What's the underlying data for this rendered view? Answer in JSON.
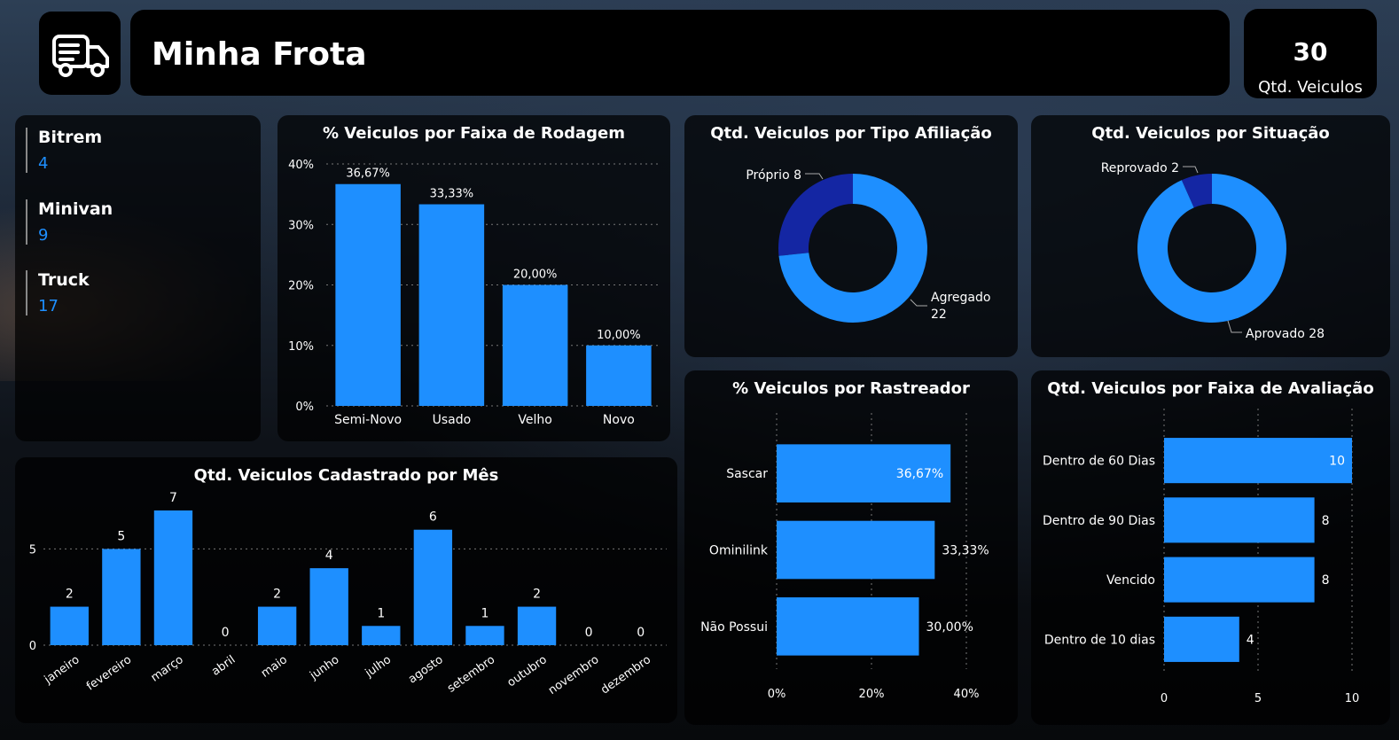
{
  "header": {
    "title": "Minha Frota",
    "kpi_value": "30",
    "kpi_label": "Qtd. Veiculos"
  },
  "icons": {
    "logo": "truck-icon"
  },
  "colors": {
    "bar": "#1e8fff",
    "dark_slice": "#1426a3"
  },
  "vehicle_types": [
    {
      "name": "Bitrem",
      "value": "4"
    },
    {
      "name": "Minivan",
      "value": "9"
    },
    {
      "name": "Truck",
      "value": "17"
    }
  ],
  "chart_data": [
    {
      "type": "bar",
      "title": "% Veiculos por Faixa de Rodagem",
      "categories": [
        "Semi-Novo",
        "Usado",
        "Velho",
        "Novo"
      ],
      "values": [
        36.67,
        33.33,
        20.0,
        10.0
      ],
      "data_labels": [
        "36,67%",
        "33,33%",
        "20,00%",
        "10,00%"
      ],
      "yticks": [
        "0%",
        "10%",
        "20%",
        "30%",
        "40%"
      ],
      "ylim": [
        0,
        40
      ]
    },
    {
      "type": "pie",
      "title": "Qtd. Veiculos por Tipo Afiliação",
      "labels": [
        "Próprio",
        "Agregado"
      ],
      "values": [
        8,
        22
      ],
      "slice_labels": [
        "Próprio 8",
        "Agregado",
        "22"
      ]
    },
    {
      "type": "pie",
      "title": "Qtd. Veiculos por Situação",
      "labels": [
        "Reprovado",
        "Aprovado"
      ],
      "values": [
        2,
        28
      ],
      "slice_labels": [
        "Reprovado 2",
        "Aprovado 28"
      ]
    },
    {
      "type": "bar",
      "title": "Qtd. Veiculos Cadastrado por Mês",
      "categories": [
        "janeiro",
        "fevereiro",
        "março",
        "abril",
        "maio",
        "junho",
        "julho",
        "agosto",
        "setembro",
        "outubro",
        "novembro",
        "dezembro"
      ],
      "values": [
        2,
        5,
        7,
        0,
        2,
        4,
        1,
        6,
        1,
        2,
        0,
        0
      ],
      "data_labels": [
        "2",
        "5",
        "7",
        "0",
        "2",
        "4",
        "1",
        "6",
        "1",
        "2",
        "0",
        "0"
      ],
      "yticks": [
        "0",
        "5"
      ],
      "ylim": [
        0,
        7
      ]
    },
    {
      "type": "bar",
      "orientation": "horizontal",
      "title": "% Veiculos por Rastreador",
      "categories": [
        "Sascar",
        "Ominilink",
        "Não Possui"
      ],
      "values": [
        36.67,
        33.33,
        30.0
      ],
      "data_labels": [
        "36,67%",
        "33,33%",
        "30,00%"
      ],
      "xticks": [
        "0%",
        "20%",
        "40%"
      ],
      "xlim": [
        0,
        40
      ]
    },
    {
      "type": "bar",
      "orientation": "horizontal",
      "title": "Qtd. Veiculos por Faixa de Avaliação",
      "categories": [
        "Dentro de 60 Dias",
        "Dentro de 90 Dias",
        "Vencido",
        "Dentro de 10 dias"
      ],
      "values": [
        10,
        8,
        8,
        4
      ],
      "data_labels": [
        "10",
        "8",
        "8",
        "4"
      ],
      "xticks": [
        "0",
        "5",
        "10"
      ],
      "xlim": [
        0,
        10
      ]
    }
  ]
}
